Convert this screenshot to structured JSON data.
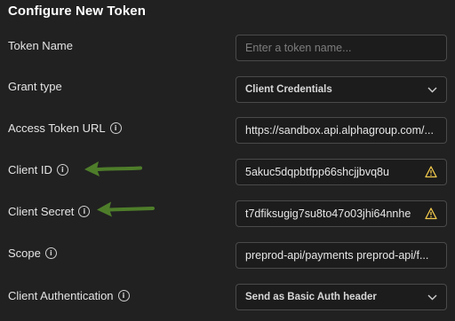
{
  "title": "Configure New Token",
  "fields": {
    "token_name": {
      "label": "Token Name",
      "placeholder": "Enter a token name...",
      "value": ""
    },
    "grant_type": {
      "label": "Grant type",
      "value": "Client Credentials"
    },
    "access_token_url": {
      "label": "Access Token URL",
      "value": "https://sandbox.api.alphagroup.com/..."
    },
    "client_id": {
      "label": "Client ID",
      "value": "5akuc5dqpbtfpp66shcjjbvq8u"
    },
    "client_secret": {
      "label": "Client Secret",
      "value": "t7dfiksugig7su8to47o03jhi64nnhe"
    },
    "scope": {
      "label": "Scope",
      "value": "preprod-api/payments preprod-api/f..."
    },
    "client_authentication": {
      "label": "Client Authentication",
      "value": "Send as Basic Auth header"
    }
  },
  "icons": {
    "info": "info-circle-icon",
    "warning": "warning-triangle-icon",
    "chevron": "chevron-down-icon",
    "annotation": "green-arrow-icon"
  },
  "colors": {
    "background": "#212121",
    "field_border": "#4a4a4a",
    "warning": "#f2c94c",
    "annotation_arrow": "#4e7d2a"
  }
}
